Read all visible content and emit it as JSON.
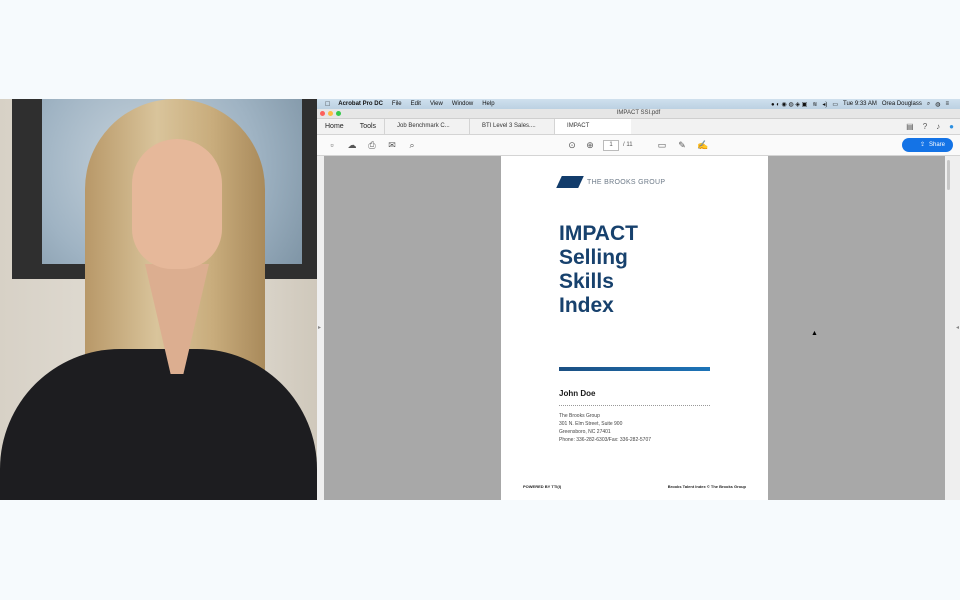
{
  "menubar": {
    "app": "Acrobat Pro DC",
    "items": [
      "File",
      "Edit",
      "View",
      "Window",
      "Help"
    ],
    "time": "Tue 9:33 AM",
    "user": "Orea Douglass"
  },
  "window": {
    "title": "IMPACT SSI.pdf"
  },
  "tabs": {
    "home": "Home",
    "tools": "Tools",
    "docs": [
      {
        "label": "Job Benchmark C..."
      },
      {
        "label": "BTI Level 3 Sales...."
      },
      {
        "label": "IMPACT SSI.pdf",
        "close": "×"
      }
    ]
  },
  "toolbar": {
    "page_current": "1",
    "page_total": "/ 11",
    "share_label": "Share"
  },
  "doc": {
    "logo_text": "THE BROOKS GROUP",
    "title_lines": [
      "IMPACT",
      "Selling",
      "Skills",
      "Index"
    ],
    "name": "John Doe",
    "address": [
      "The Brooks Group",
      "301 N. Elm Street, Suite 900",
      "Greensboro, NC 27401",
      "Phone: 336-282-6303/Fax: 336-282-5707"
    ],
    "footer_left": "POWERED BY TTI(I)",
    "footer_right": "Brooks Talent Index © The Brooks Group"
  },
  "colors": {
    "accent": "#1473e6",
    "brand": "#17416d"
  }
}
